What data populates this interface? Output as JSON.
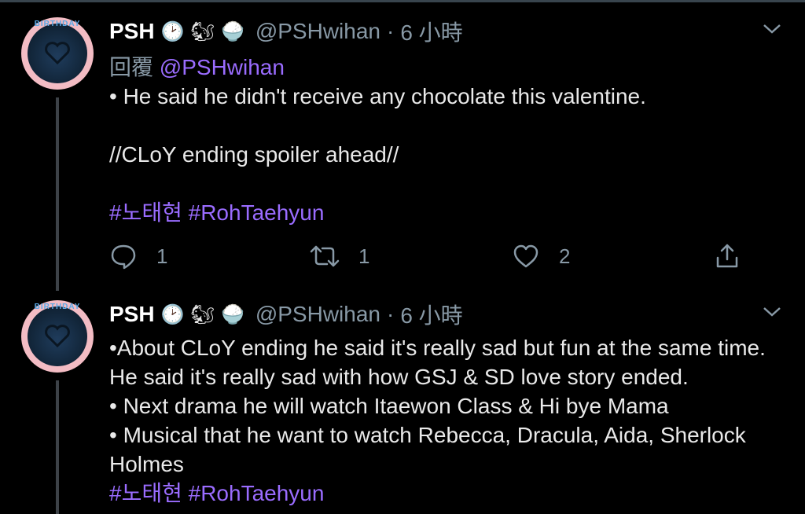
{
  "tweets": [
    {
      "name": "PSH",
      "emojis": [
        "🕑",
        "🐿",
        "🍚"
      ],
      "handle": "@PSHwihan",
      "sep": "·",
      "time": "6 小時",
      "reply_prefix": "回覆",
      "reply_handle": "@PSHwihan",
      "lines": [
        "• He said he didn't receive any chocolate this valentine.",
        "",
        "//CLoY ending spoiler ahead//",
        ""
      ],
      "tags": "#노태현 #RohTaehyun",
      "actions": {
        "replies": "1",
        "retweets": "1",
        "likes": "2"
      }
    },
    {
      "name": "PSH",
      "emojis": [
        "🕑",
        "🐿",
        "🍚"
      ],
      "handle": "@PSHwihan",
      "sep": "·",
      "time": "6 小時",
      "lines": [
        "•About CLoY ending he said it's really sad but fun at the same time. He said it's really sad with how GSJ & SD love story ended.",
        "• Next drama he will watch Itaewon Class & Hi bye Mama",
        "• Musical that he want to watch Rebecca, Dracula, Aida, Sherlock Holmes"
      ],
      "tags": "#노태현 #RohTaehyun"
    }
  ],
  "avatar_text": "BIRTHDAY",
  "colors": {
    "link": "#9a6cff",
    "muted": "#8899a6",
    "avatar_ring": "#f3bcc4"
  },
  "icons": [
    "chevron-down-icon",
    "reply-icon",
    "retweet-icon",
    "like-icon",
    "share-icon"
  ]
}
